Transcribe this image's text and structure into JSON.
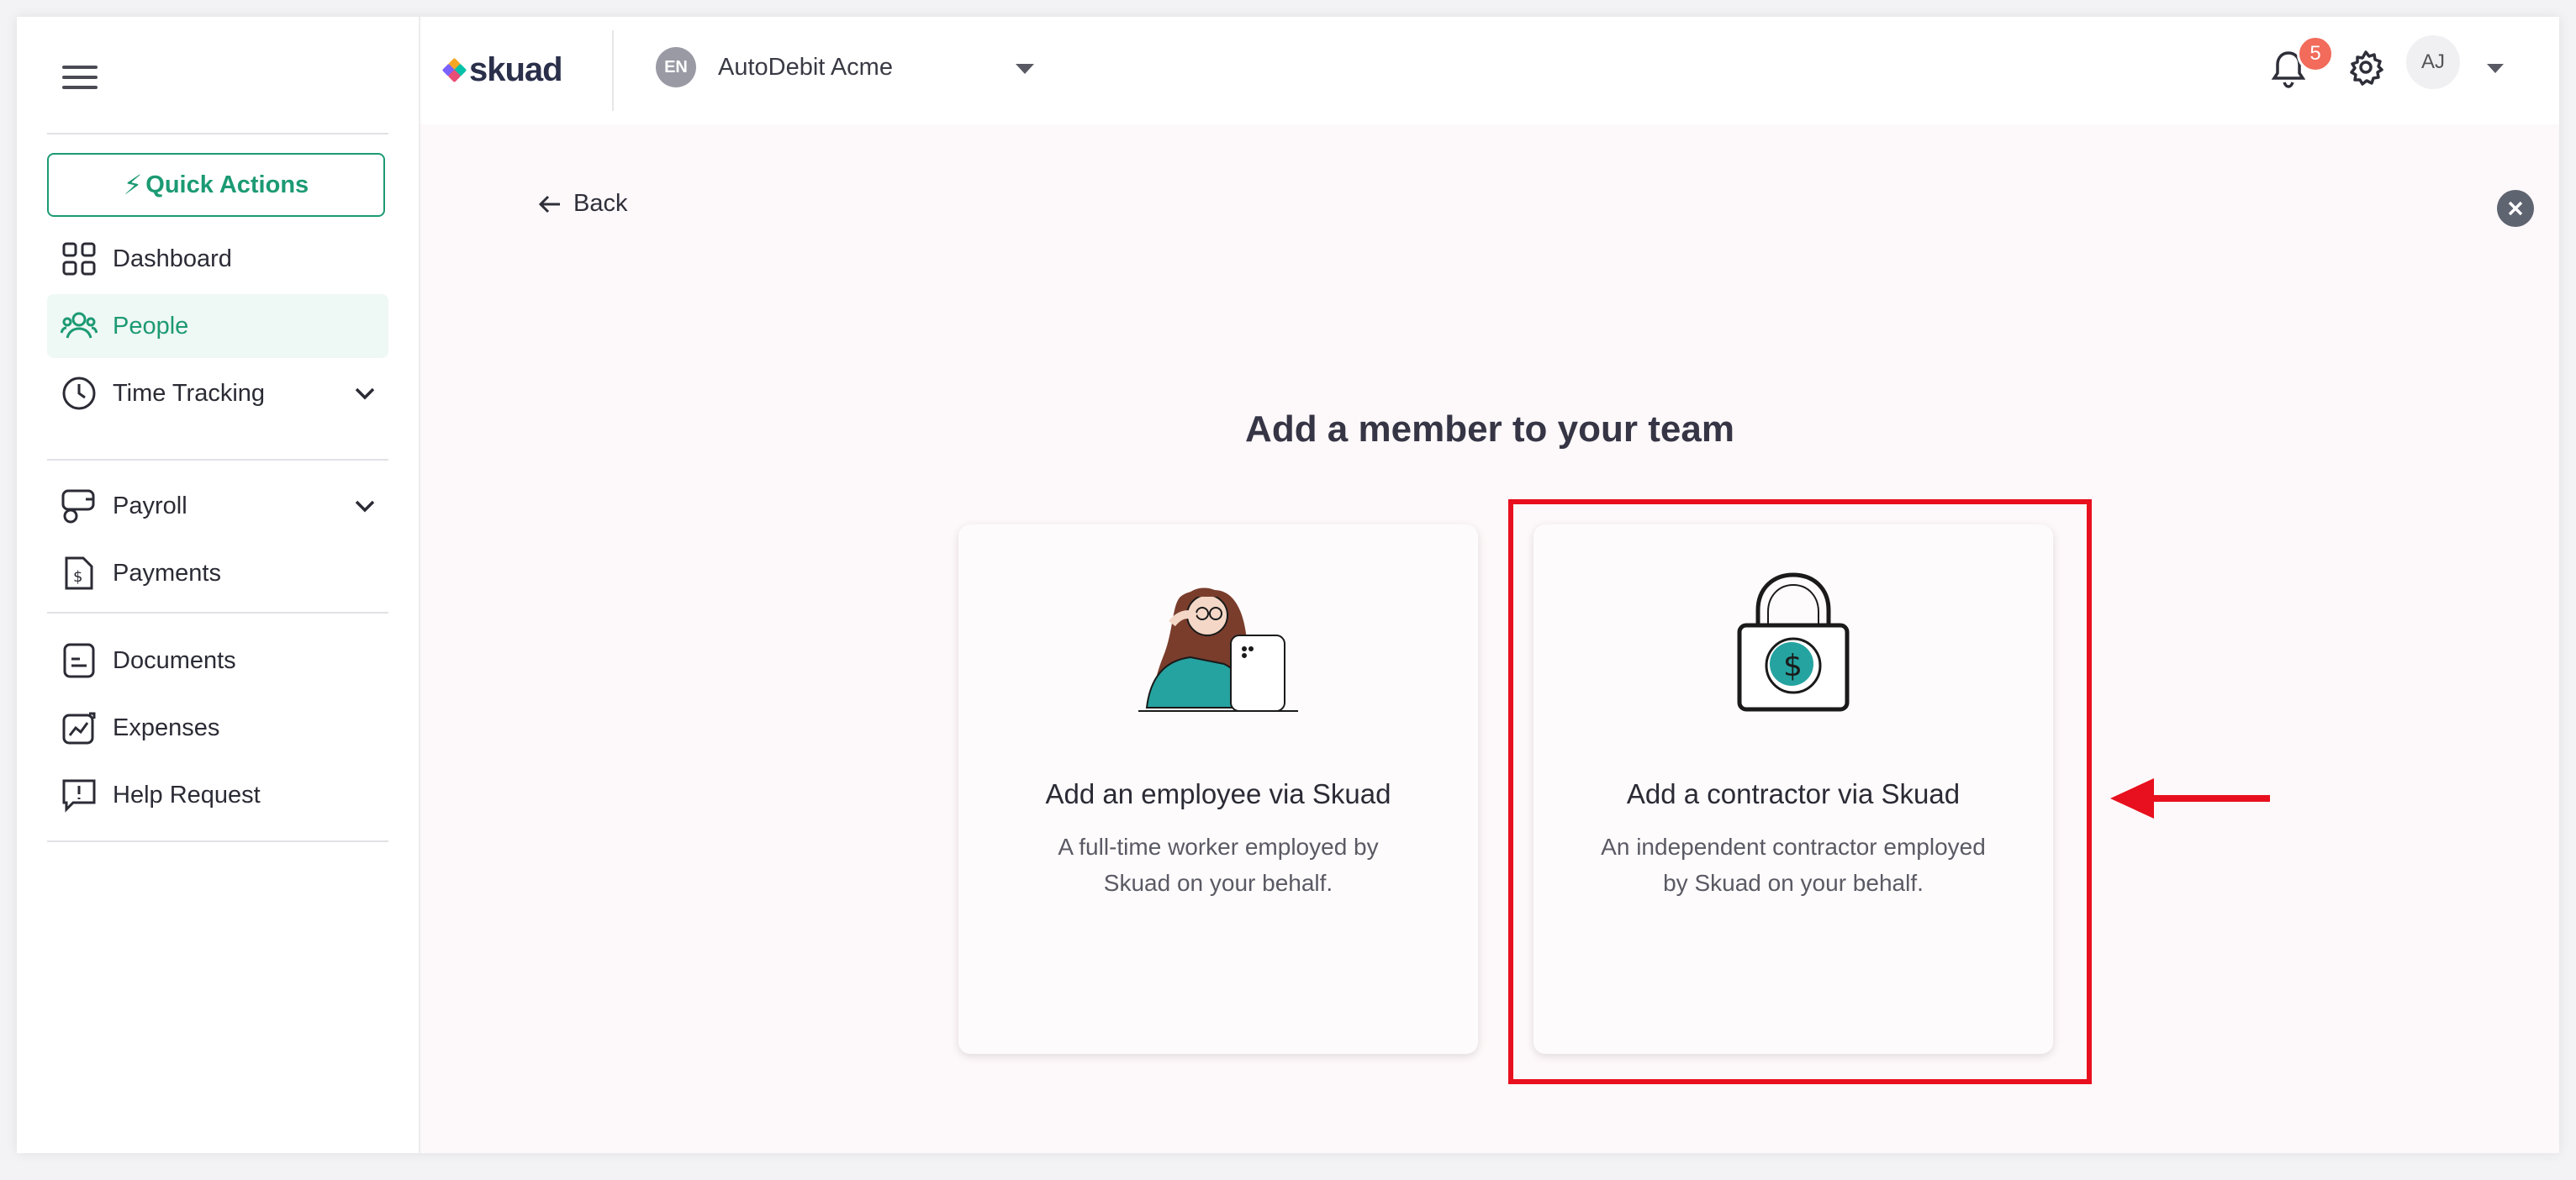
{
  "sidebar": {
    "quick_actions_label": "Quick Actions",
    "items": [
      {
        "label": "Dashboard",
        "icon": "dashboard-icon"
      },
      {
        "label": "People",
        "icon": "people-icon",
        "active": true
      },
      {
        "label": "Time Tracking",
        "icon": "clock-icon",
        "expandable": true
      },
      {
        "label": "Payroll",
        "icon": "payroll-icon",
        "expandable": true
      },
      {
        "label": "Payments",
        "icon": "payments-icon"
      },
      {
        "label": "Documents",
        "icon": "documents-icon"
      },
      {
        "label": "Expenses",
        "icon": "expenses-icon"
      },
      {
        "label": "Help Request",
        "icon": "help-request-icon"
      }
    ]
  },
  "header": {
    "logo_text": "skuad",
    "org_badge": "EN",
    "org_name": "AutoDebit Acme",
    "notification_count": "5",
    "user_initials": "AJ"
  },
  "main": {
    "back_label": "Back",
    "title": "Add a member to your team",
    "cards": [
      {
        "title": "Add an employee via Skuad",
        "description": "A full-time worker employed by Skuad on your behalf."
      },
      {
        "title": "Add a contractor via Skuad",
        "description": "An independent contractor employed by Skuad on your behalf."
      }
    ]
  },
  "colors": {
    "accent": "#1c9a73",
    "notification": "#f26b5b",
    "highlight": "#e8101e"
  }
}
